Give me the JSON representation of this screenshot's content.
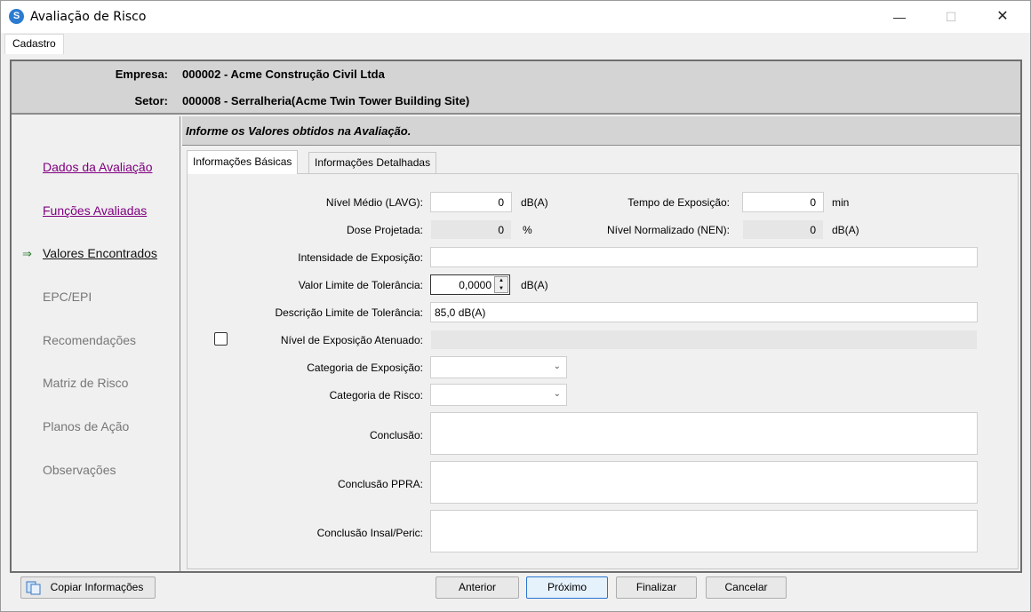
{
  "window": {
    "title": "Avaliação de Risco",
    "min_icon": "—",
    "max_icon": "☐",
    "close_icon": "✕"
  },
  "menu": {
    "tab": "Cadastro"
  },
  "header": {
    "empresa_label": "Empresa:",
    "empresa_value": "000002 - Acme Construção Civil Ltda",
    "setor_label": "Setor:",
    "setor_value": "000008 - Serralheria(Acme Twin Tower Building Site)"
  },
  "sidebar": {
    "items": [
      {
        "label": "Dados da Avaliação"
      },
      {
        "label": "Funções Avaliadas"
      },
      {
        "label": "Valores Encontrados"
      },
      {
        "label": "EPC/EPI"
      },
      {
        "label": "Recomendações"
      },
      {
        "label": "Matriz de Risco"
      },
      {
        "label": "Planos de Ação"
      },
      {
        "label": "Observações"
      }
    ],
    "arrow": "⇒"
  },
  "content": {
    "heading": "Informe os Valores obtidos na Avaliação.",
    "tabs": [
      "Informações Básicas",
      "Informações Detalhadas"
    ]
  },
  "form": {
    "nivel_medio_label": "Nível Médio (LAVG):",
    "nivel_medio_value": "0",
    "nivel_medio_unit": "dB(A)",
    "tempo_label": "Tempo de Exposição:",
    "tempo_value": "0",
    "tempo_unit": "min",
    "dose_label": "Dose Projetada:",
    "dose_value": "0",
    "dose_unit": "%",
    "nen_label": "Nível Normalizado (NEN):",
    "nen_value": "0",
    "nen_unit": "dB(A)",
    "intensidade_label": "Intensidade de Exposição:",
    "intensidade_value": "",
    "vlt_label": "Valor Limite de Tolerância:",
    "vlt_value": "0,0000",
    "vlt_unit": "dB(A)",
    "desc_vlt_label": "Descrição Limite de Tolerância:",
    "desc_vlt_value": "85,0 dB(A)",
    "atenuado_label": "Nível de Exposição Atenuado:",
    "atenuado_checked": false,
    "cat_exposicao_label": "Categoria de Exposição:",
    "cat_exposicao_value": "",
    "cat_risco_label": "Categoria de Risco:",
    "cat_risco_value": "",
    "conclusao_label": "Conclusão:",
    "conclusao_ppra_label": "Conclusão PPRA:",
    "conclusao_insal_label": "Conclusão Insal/Peric:"
  },
  "buttons": {
    "copiar": "Copiar Informações",
    "anterior": "Anterior",
    "proximo": "Próximo",
    "finalizar": "Finalizar",
    "cancelar": "Cancelar"
  },
  "colors": {
    "visited_link": "#800080",
    "header_band": "#d4d4d4",
    "primary_border": "#2a74d0"
  }
}
